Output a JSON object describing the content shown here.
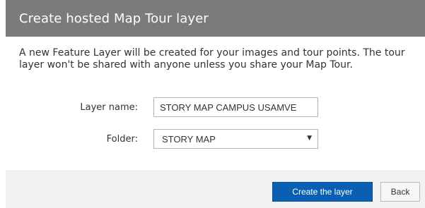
{
  "dialog": {
    "title": "Create hosted Map Tour layer",
    "description": "A new Feature Layer will be created for your images and tour points. The tour layer won't be shared with anyone unless you share your Map Tour."
  },
  "form": {
    "layer_name_label": "Layer name:",
    "layer_name_value": "STORY MAP CAMPUS USAMVE",
    "folder_label": "Folder:",
    "folder_value": "STORY MAP",
    "folder_caret": "▼"
  },
  "footer": {
    "create_label": "Create the layer",
    "back_label": "Back"
  },
  "colors": {
    "header_bg": "#7b7b7b",
    "primary_button": "#0b5fb3",
    "footer_bg": "#f2f2f2"
  }
}
